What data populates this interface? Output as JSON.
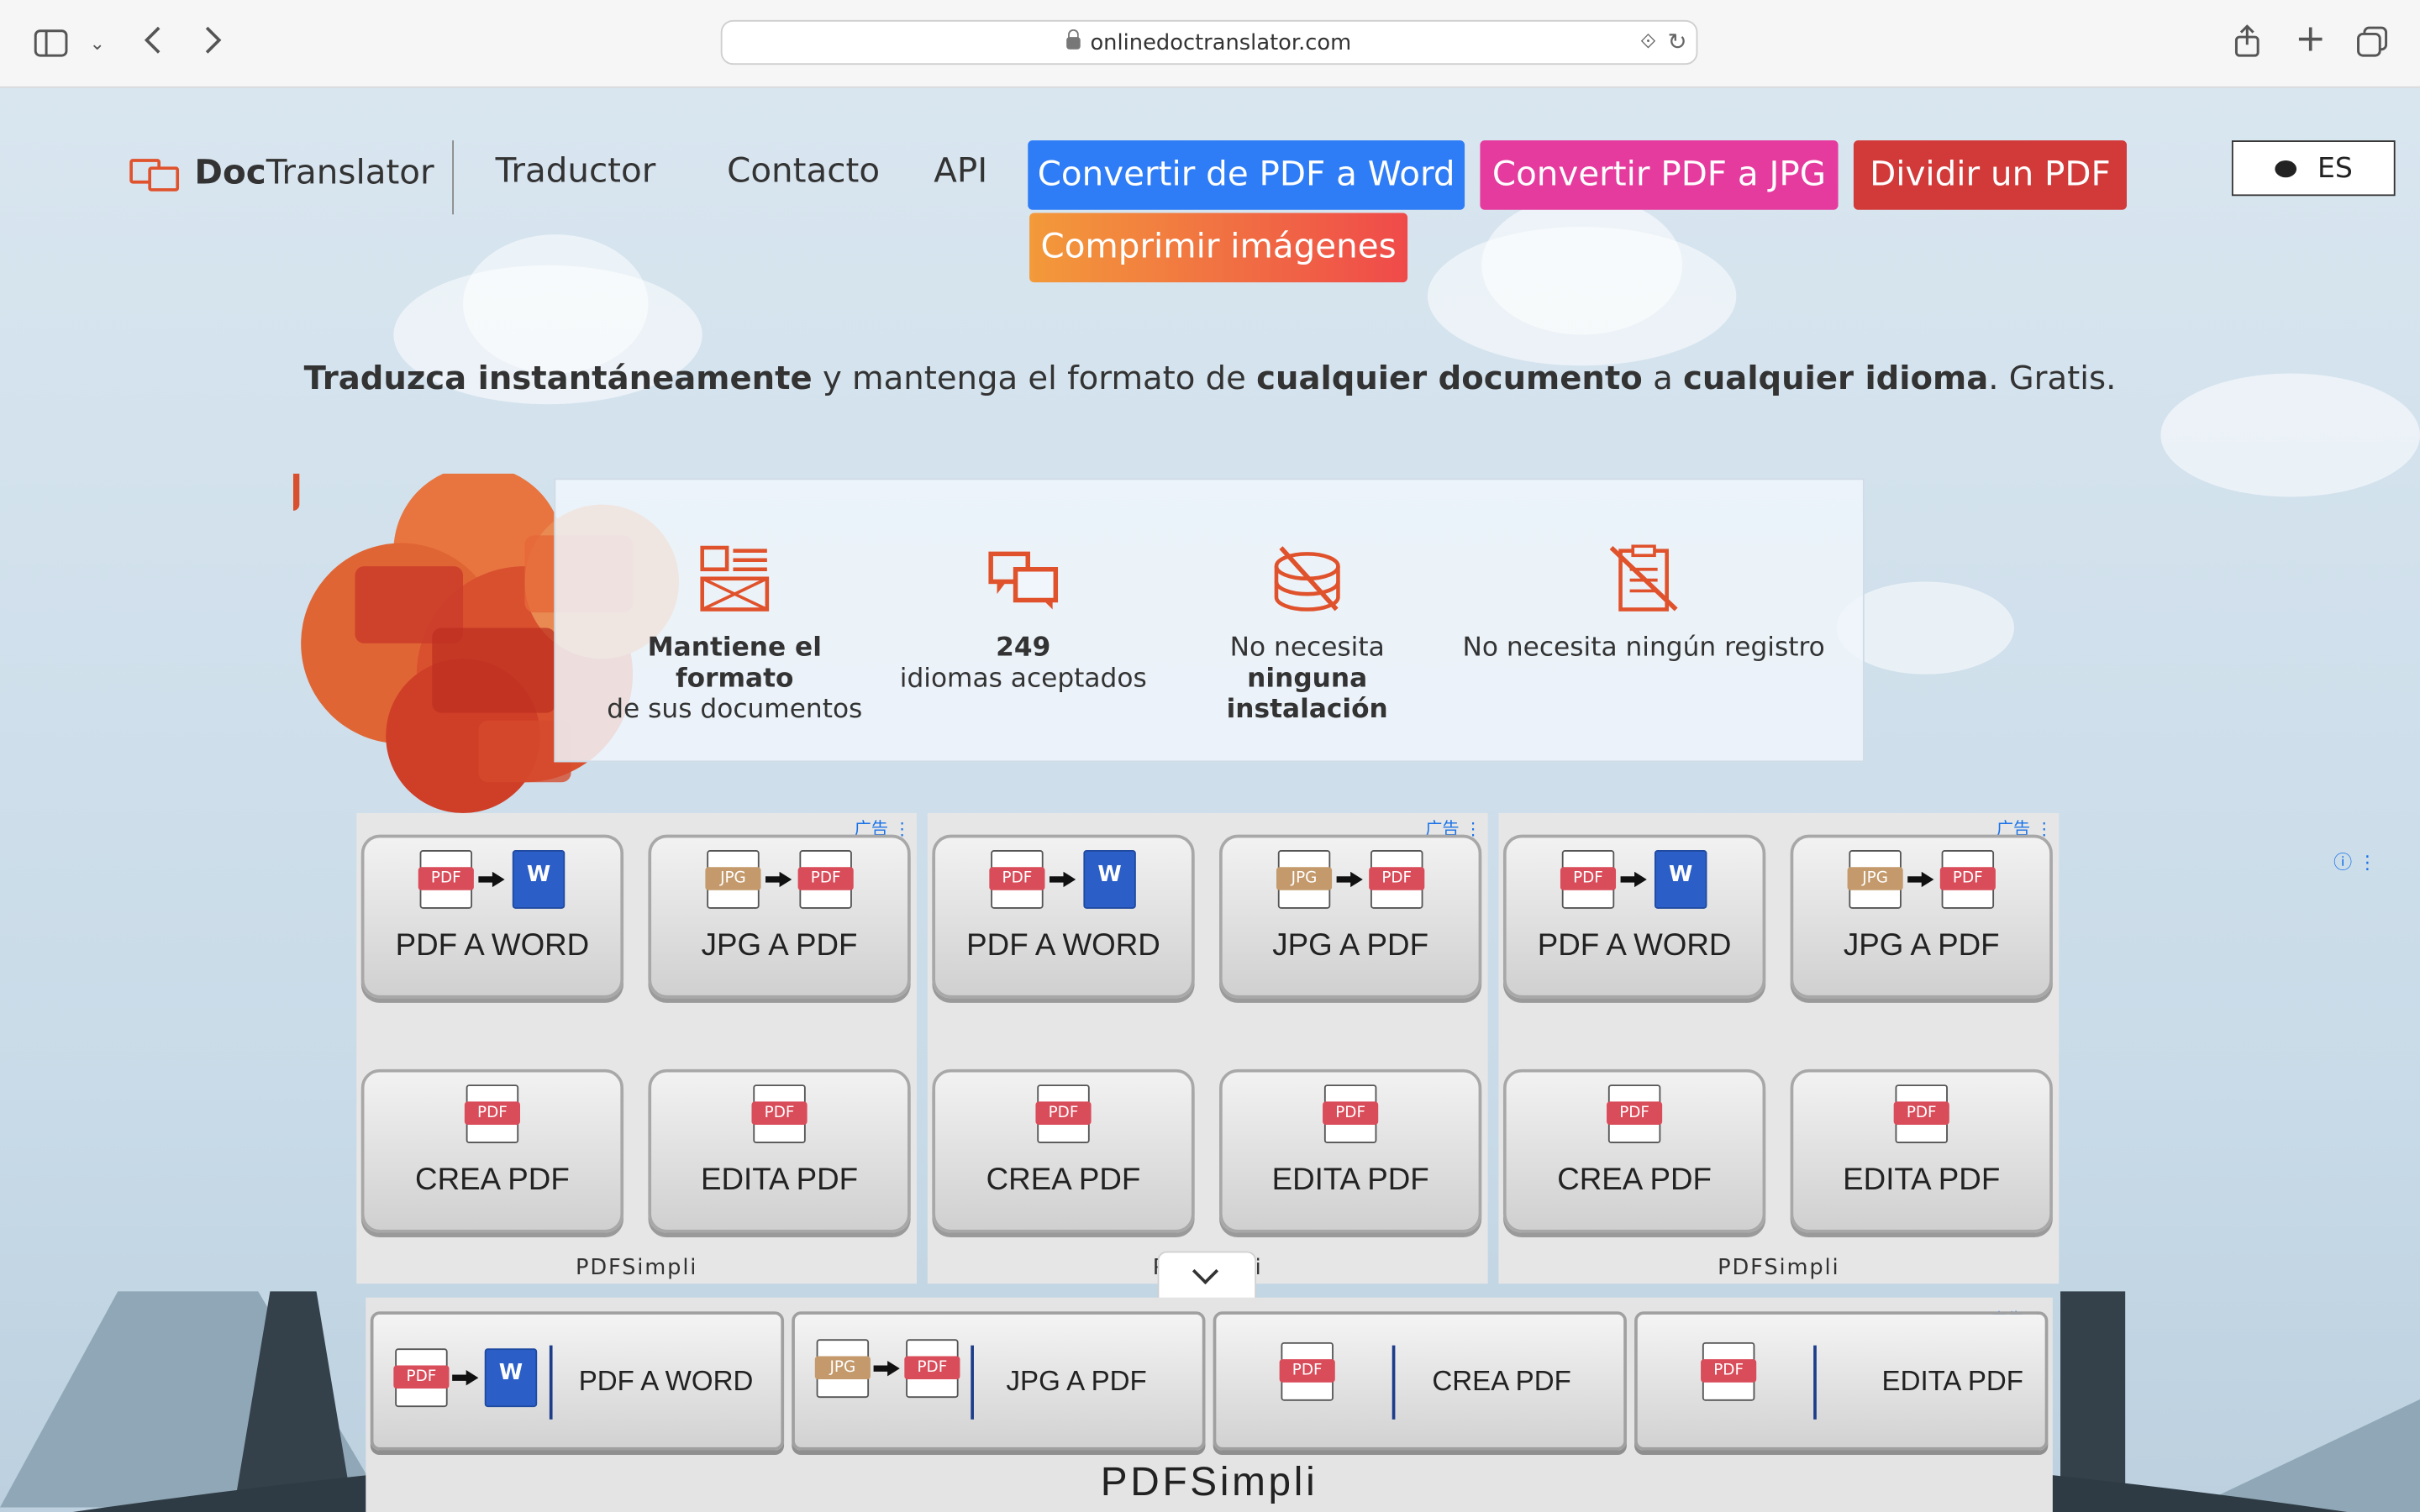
{
  "browser": {
    "url": "onlinedoctranslator.com"
  },
  "header": {
    "logo_bold": "Doc",
    "logo_rest": "Translator",
    "nav": [
      "Traductor",
      "Contacto",
      "API"
    ],
    "buttons": [
      {
        "label": "Convertir de PDF a Word",
        "color": "#2f7df6"
      },
      {
        "label": "Convertir PDF a JPG",
        "color": "#e53a9e"
      },
      {
        "label": "Dividir un PDF",
        "color": "#d23a3a"
      },
      {
        "label": "Comprimir imágenes",
        "color": "#f07a3a"
      }
    ],
    "language": "ES"
  },
  "tagline": {
    "p1": "Traduzca instantáneamente",
    "p2": " y mantenga el formato de ",
    "p3": "cualquier documento",
    "p4": " a ",
    "p5": "cualquier idioma",
    "p6": ". Gratis."
  },
  "features": [
    {
      "icon": "format-icon",
      "line1": "Mantiene el formato",
      "line2": "de sus documentos",
      "bold": 1
    },
    {
      "icon": "languages-icon",
      "line1": "249",
      "line2": "idiomas aceptados",
      "bold": 1
    },
    {
      "icon": "no-install-icon",
      "line1": "No necesita",
      "line2": "ninguna instalación",
      "bold": 2
    },
    {
      "icon": "no-registration-icon",
      "line1": "No necesita ningún registro",
      "line2": "",
      "bold": 0
    }
  ],
  "ads": {
    "tag": "广告",
    "tiles": [
      "PDF A WORD",
      "JPG A PDF",
      "CREA PDF",
      "EDITA PDF"
    ],
    "brand_left": "PDFSimpli",
    "brand_mid": "P",
    "brand_mid_tail": "li",
    "brand_right": "PDFSimpli",
    "bottom_tiles": [
      "PDF A WORD",
      "JPG A PDF",
      "CREA PDF",
      "EDITA PDF"
    ],
    "bottom_brand": "PDFSimpli"
  },
  "icons": {
    "pdf": "PDF",
    "jpg": "JPG",
    "word": "W"
  }
}
